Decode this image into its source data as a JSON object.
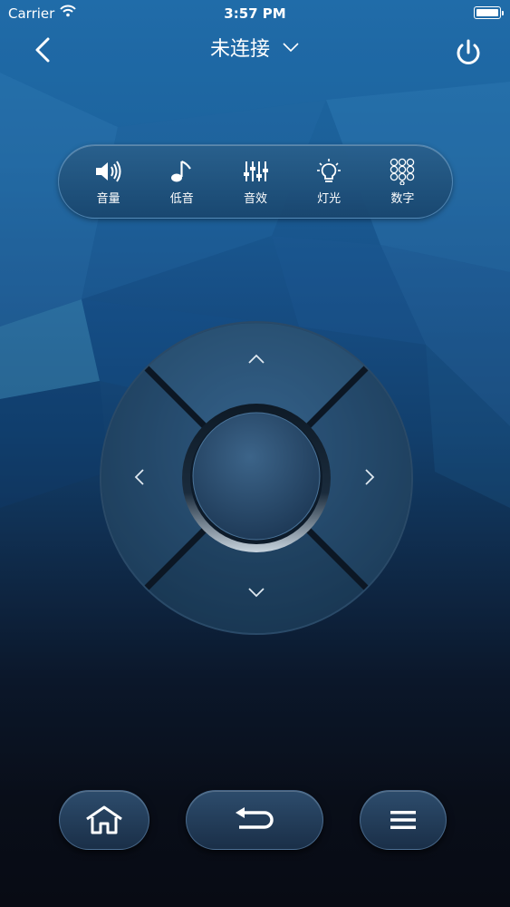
{
  "status_bar": {
    "carrier": "Carrier",
    "time": "3:57 PM",
    "icons": [
      "wifi-icon",
      "battery-icon"
    ]
  },
  "nav": {
    "title": "未连接",
    "back_icon": "back-chevron-icon",
    "dropdown_icon": "chevron-down-icon",
    "power_icon": "power-icon"
  },
  "toolbar": {
    "items": [
      {
        "label": "音量",
        "icon": "speaker-icon"
      },
      {
        "label": "低音",
        "icon": "music-note-icon"
      },
      {
        "label": "音效",
        "icon": "equalizer-icon"
      },
      {
        "label": "灯光",
        "icon": "light-bulb-icon"
      },
      {
        "label": "数字",
        "icon": "number-pad-icon"
      }
    ]
  },
  "dpad": {
    "icons": [
      "up-arrow-icon",
      "down-arrow-icon",
      "left-arrow-icon",
      "right-arrow-icon"
    ],
    "center": "ok-button"
  },
  "bottom": {
    "icons": [
      "home-icon",
      "return-icon",
      "menu-icon"
    ]
  },
  "colors": {
    "bg_top": "#1f6aa6",
    "bg_bottom": "#080b14",
    "pill_border": "#78afdc"
  }
}
